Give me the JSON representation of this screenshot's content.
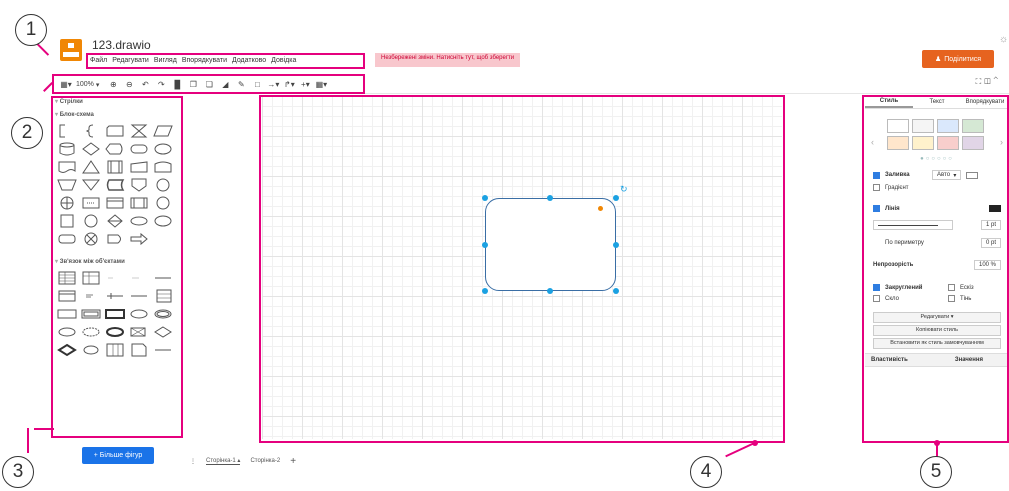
{
  "app": {
    "doc_title": "123.drawio",
    "menu": [
      "Файл",
      "Редагувати",
      "Вигляд",
      "Впорядкувати",
      "Додатково",
      "Довідка"
    ],
    "unsaved_notice": "Незбережені зміни. Натисніть тут, щоб зберегти",
    "share_label": "Поділитися",
    "zoom": "100%"
  },
  "left_panel": {
    "top_label": "Стрілки",
    "section_flowchart": "Блок-схема",
    "section_relations": "Зв'язок між об'єктами",
    "more_shapes": "+ Більше фігур"
  },
  "pages": {
    "tab1": "Сторінка-1",
    "tab2": "Сторінка-2"
  },
  "right_panel": {
    "tabs": [
      "Стиль",
      "Текст",
      "Впорядкувати"
    ],
    "fill_label": "Заливка",
    "fill_value": "Авто",
    "gradient_label": "Градієнт",
    "line_label": "Лінія",
    "line_width": "1 pt",
    "perimeter_label": "По периметру",
    "perimeter_value": "0 pt",
    "opacity_label": "Непрозорість",
    "opacity_value": "100 %",
    "rounded_label": "Закруглений",
    "sketch_label": "Ескіз",
    "glass_label": "Скло",
    "shadow_label": "Тінь",
    "edit_btn": "Редагувати",
    "copy_style_btn": "Копіювати стиль",
    "set_default_btn": "Встановити як стиль замовчуванням",
    "prop_col": "Властивість",
    "value_col": "Значення"
  },
  "annotations": [
    "1",
    "2",
    "3",
    "4",
    "5"
  ],
  "colors": {
    "accent": "#e5007e",
    "brand": "#f08705",
    "share": "#e6631f",
    "selection": "#1ba1e2"
  }
}
